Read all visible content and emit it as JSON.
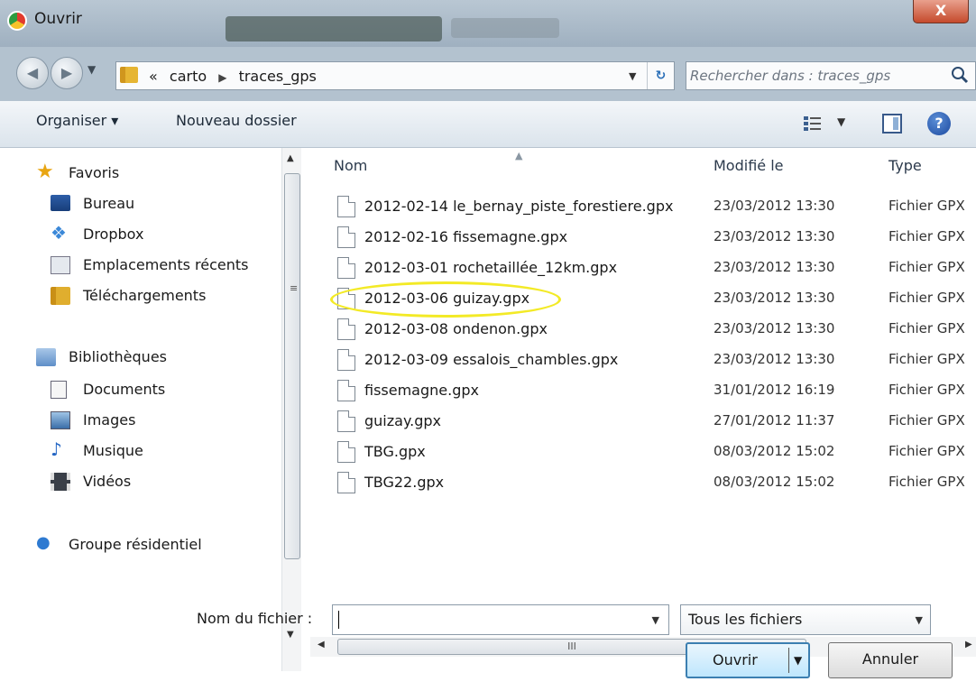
{
  "window": {
    "title": "Ouvrir",
    "close_label": "X"
  },
  "address": {
    "prefix": "«",
    "crumbs": [
      "carto",
      "traces_gps"
    ],
    "search_placeholder": "Rechercher dans : traces_gps"
  },
  "toolbar": {
    "organiser_label": "Organiser ▾",
    "nouveau_label": "Nouveau dossier"
  },
  "nav": {
    "favoris": "Favoris",
    "bureau": "Bureau",
    "dropbox": "Dropbox",
    "emplacements": "Emplacements récents",
    "telechargements": "Téléchargements",
    "bibliotheques": "Bibliothèques",
    "documents": "Documents",
    "images": "Images",
    "musique": "Musique",
    "videos": "Vidéos",
    "groupe": "Groupe résidentiel"
  },
  "columns": {
    "name": "Nom",
    "modified": "Modifié le",
    "type": "Type"
  },
  "files": [
    {
      "name": "2012-02-14 le_bernay_piste_forestiere.gpx",
      "date": "23/03/2012 13:30",
      "type": "Fichier GPX"
    },
    {
      "name": "2012-02-16 fissemagne.gpx",
      "date": "23/03/2012 13:30",
      "type": "Fichier GPX"
    },
    {
      "name": "2012-03-01 rochetaillée_12km.gpx",
      "date": "23/03/2012 13:30",
      "type": "Fichier GPX"
    },
    {
      "name": "2012-03-06 guizay.gpx",
      "date": "23/03/2012 13:30",
      "type": "Fichier GPX"
    },
    {
      "name": "2012-03-08 ondenon.gpx",
      "date": "23/03/2012 13:30",
      "type": "Fichier GPX"
    },
    {
      "name": "2012-03-09 essalois_chambles.gpx",
      "date": "23/03/2012 13:30",
      "type": "Fichier GPX"
    },
    {
      "name": "fissemagne.gpx",
      "date": "31/01/2012 16:19",
      "type": "Fichier GPX"
    },
    {
      "name": "guizay.gpx",
      "date": "27/01/2012 11:37",
      "type": "Fichier GPX"
    },
    {
      "name": "TBG.gpx",
      "date": "08/03/2012 15:02",
      "type": "Fichier GPX"
    },
    {
      "name": "TBG22.gpx",
      "date": "08/03/2012 15:02",
      "type": "Fichier GPX"
    }
  ],
  "highlighted_file": "2012-03-06 guizay.gpx",
  "bottom": {
    "filename_label": "Nom du fichier :",
    "filename_value": "",
    "filter_label": "Tous les fichiers",
    "open_label": "Ouvrir",
    "cancel_label": "Annuler"
  },
  "colors": {
    "highlight_ring": "#f3ea26",
    "accent": "#3c7fb1"
  }
}
